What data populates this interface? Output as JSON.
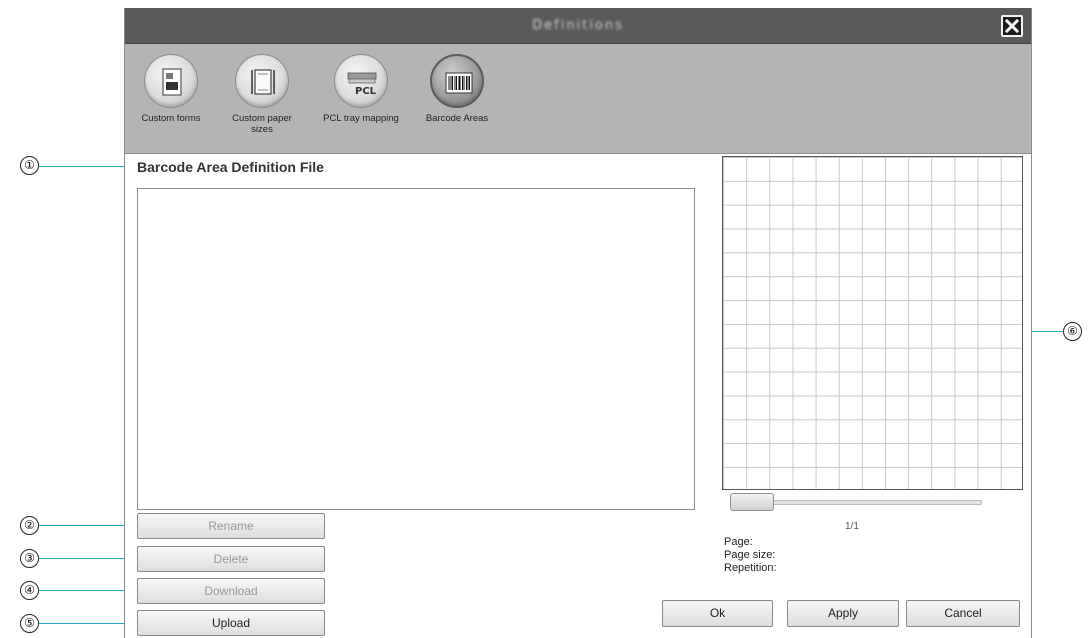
{
  "window": {
    "title": "Definitions"
  },
  "toolbar": {
    "items": [
      {
        "label": "Custom forms",
        "icon": "custom-forms-icon",
        "active": false
      },
      {
        "label": "Custom paper sizes",
        "icon": "custom-paper-sizes-icon",
        "active": false
      },
      {
        "label": "PCL tray mapping",
        "icon": "pcl-tray-mapping-icon",
        "active": false
      },
      {
        "label": "Barcode Areas",
        "icon": "barcode-areas-icon",
        "active": true
      }
    ]
  },
  "main": {
    "section_title": "Barcode Area Definition File",
    "file_list": []
  },
  "buttons": {
    "rename": "Rename",
    "delete": "Delete",
    "download": "Download",
    "upload": "Upload",
    "ok": "Ok",
    "apply": "Apply",
    "cancel": "Cancel"
  },
  "preview": {
    "page_counter": "1/1",
    "slider_position": 0,
    "page_label": "Page:",
    "page_size_label": "Page size:",
    "repetition_label": "Repetition:"
  },
  "callouts": [
    "①",
    "②",
    "③",
    "④",
    "⑤",
    "⑥"
  ],
  "colors": {
    "titlebar": "#5a5a5a",
    "toolbar": "#b4b4b4",
    "leader_line": "#23a6c7"
  }
}
